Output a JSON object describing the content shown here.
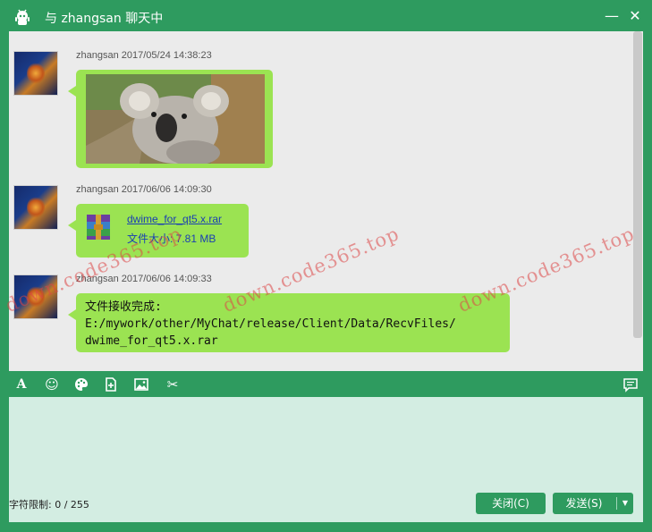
{
  "window": {
    "title": "与 zhangsan 聊天中",
    "minimize_symbol": "—",
    "close_symbol": "✕"
  },
  "messages": [
    {
      "sender": "zhangsan",
      "time": "2017/05/24 14:38:23",
      "type": "image"
    },
    {
      "sender": "zhangsan",
      "time": "2017/06/06 14:09:30",
      "type": "file",
      "file_name": "dwime_for_qt5.x.rar",
      "file_size_text": "文件大小: 7.81 MB"
    },
    {
      "sender": "zhangsan",
      "time": "2017/06/06 14:09:33",
      "type": "text",
      "text": "文件接收完成:\nE:/mywork/other/MyChat/release/Client/Data/RecvFiles/\ndwime_for_qt5.x.rar"
    }
  ],
  "toolbar": {
    "font_icon": "A",
    "emoji_icon": "☺",
    "palette_icon": "palette-icon",
    "add_file_icon": "add-file-icon",
    "image_icon": "image-icon",
    "scissors_icon": "✂",
    "history_icon": "chat-history-icon"
  },
  "input": {
    "char_limit": "字符限制: 0 / 255",
    "close_label": "关闭(C)",
    "send_label": "发送(S)",
    "dropdown_symbol": "▼"
  },
  "watermark": {
    "text": "down.code365.top"
  }
}
